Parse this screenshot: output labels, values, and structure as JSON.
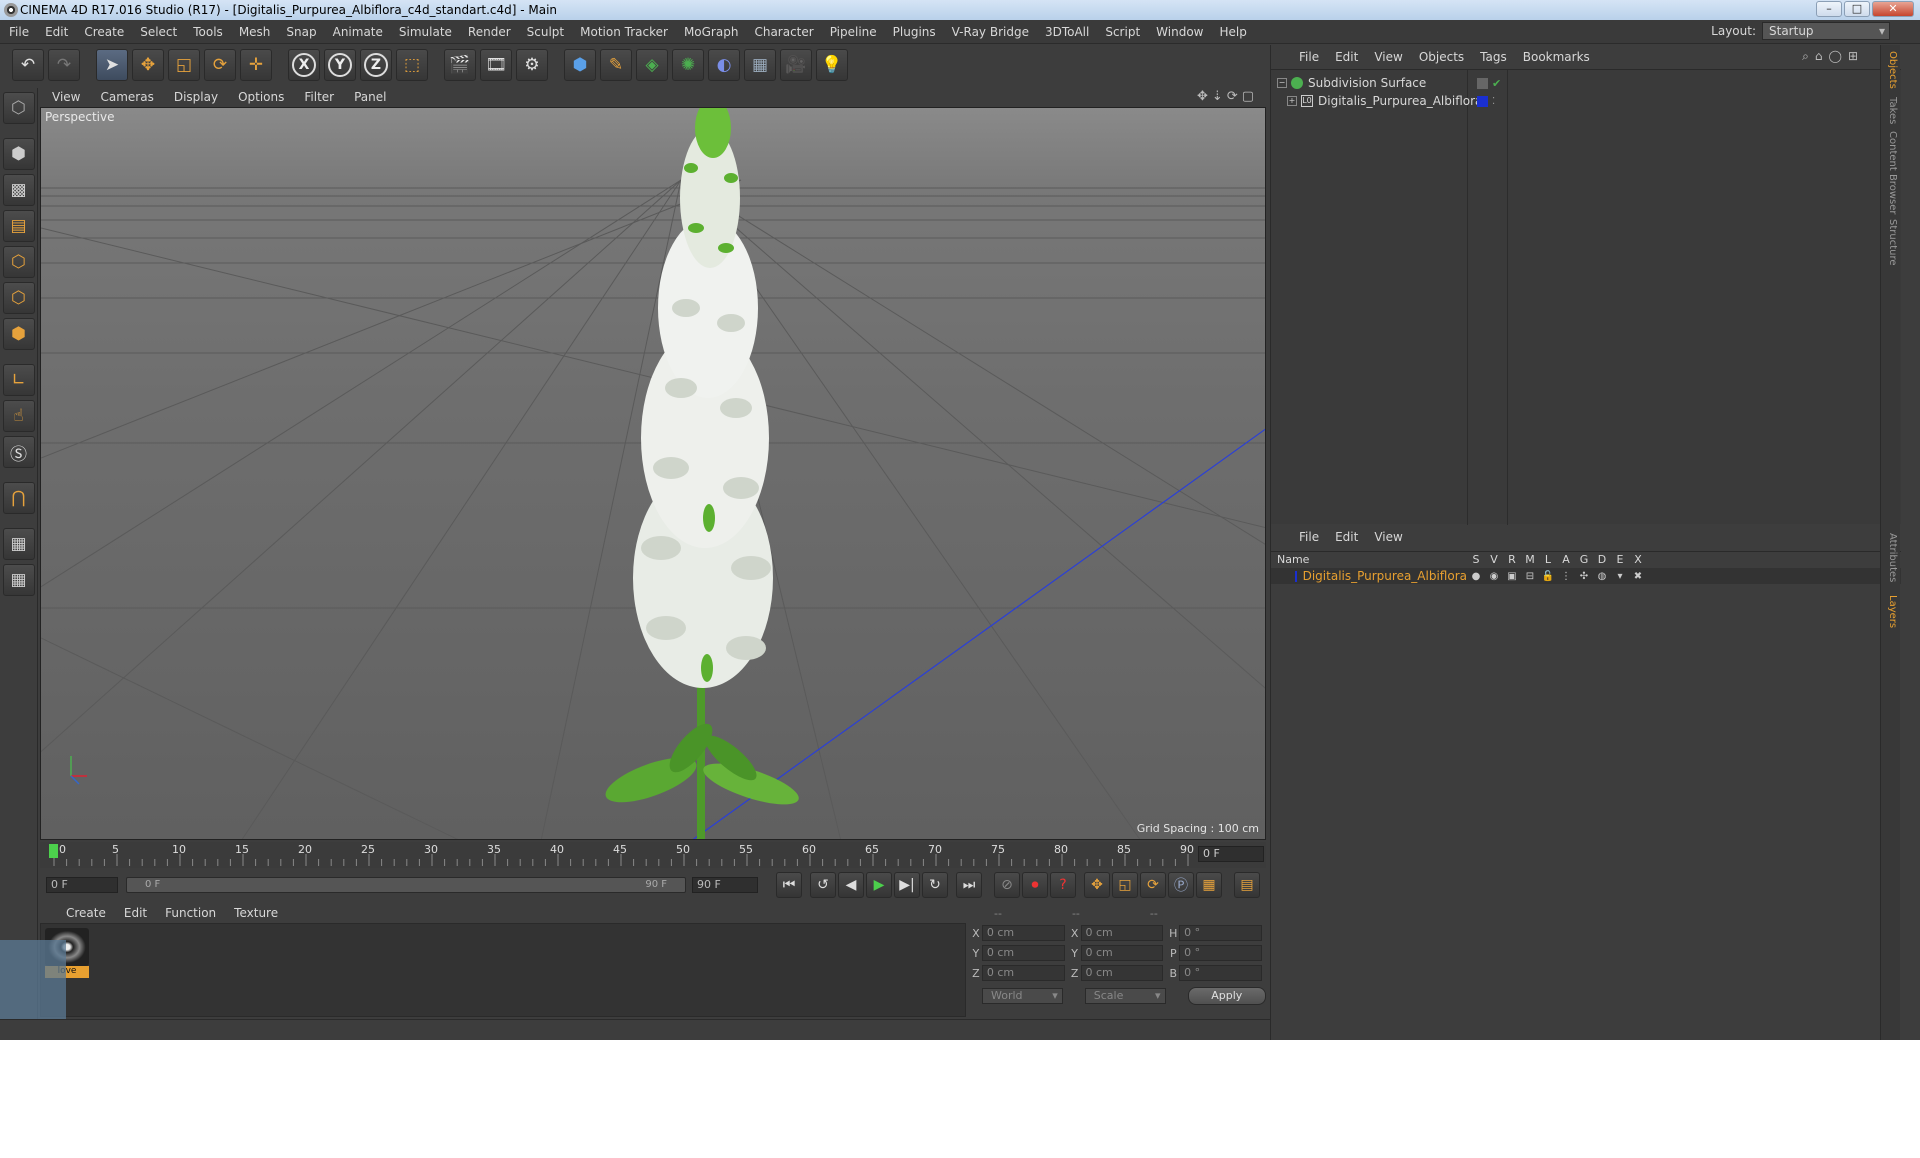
{
  "window": {
    "title": "CINEMA 4D R17.016 Studio (R17) - [Digitalis_Purpurea_Albiflora_c4d_standart.c4d] - Main"
  },
  "menubar": {
    "items": [
      "File",
      "Edit",
      "Create",
      "Select",
      "Tools",
      "Mesh",
      "Snap",
      "Animate",
      "Simulate",
      "Render",
      "Sculpt",
      "Motion Tracker",
      "MoGraph",
      "Character",
      "Pipeline",
      "Plugins",
      "V-Ray Bridge",
      "3DToAll",
      "Script",
      "Window",
      "Help"
    ],
    "layout_label": "Layout:",
    "layout_value": "Startup"
  },
  "toolbar": {
    "icons": [
      "undo-icon",
      "redo-icon",
      "select-arrow-icon",
      "move-icon",
      "scale-icon",
      "rotate-icon",
      "add-icon",
      "x-axis-icon",
      "y-axis-icon",
      "z-axis-icon",
      "coordinate-system-icon",
      "render-view-icon",
      "render-picture-viewer-icon",
      "render-settings-icon",
      "cube-icon",
      "pen-icon",
      "subdivision-icon",
      "mograph-icon",
      "deformer-icon",
      "floor-icon",
      "camera-icon",
      "light-icon"
    ],
    "axis_x": "X",
    "axis_y": "Y",
    "axis_z": "Z"
  },
  "viewport": {
    "menu": [
      "View",
      "Cameras",
      "Display",
      "Options",
      "Filter",
      "Panel"
    ],
    "label": "Perspective",
    "grid_spacing": "Grid Spacing : 100 cm"
  },
  "timeline": {
    "ticks": [
      "0",
      "5",
      "10",
      "15",
      "20",
      "25",
      "30",
      "35",
      "40",
      "45",
      "50",
      "55",
      "60",
      "65",
      "70",
      "75",
      "80",
      "85",
      "90"
    ],
    "current_frame": "0 F",
    "start_field": "0 F",
    "range_start": "0 F",
    "range_end": "90 F",
    "end_field": "90 F"
  },
  "material_manager": {
    "menu": [
      "Create",
      "Edit",
      "Function",
      "Texture"
    ],
    "material_label": "love"
  },
  "coordinates": {
    "headers": [
      "--",
      "--",
      "--"
    ],
    "rows": [
      {
        "a": "X",
        "av": "0 cm",
        "b": "X",
        "bv": "0 cm",
        "c": "H",
        "cv": "0 °"
      },
      {
        "a": "Y",
        "av": "0 cm",
        "b": "Y",
        "bv": "0 cm",
        "c": "P",
        "cv": "0 °"
      },
      {
        "a": "Z",
        "av": "0 cm",
        "b": "Z",
        "bv": "0 cm",
        "c": "B",
        "cv": "0 °"
      }
    ],
    "space": "World",
    "mode": "Scale",
    "apply": "Apply"
  },
  "object_manager": {
    "menu": [
      "File",
      "Edit",
      "View",
      "Objects",
      "Tags",
      "Bookmarks"
    ],
    "objects": [
      {
        "name": "Subdivision Surface"
      },
      {
        "name": "Digitalis_Purpurea_Albiflora"
      }
    ]
  },
  "layer_manager": {
    "menu": [
      "File",
      "Edit",
      "View"
    ],
    "columns": [
      "Name",
      "S",
      "V",
      "R",
      "M",
      "L",
      "A",
      "G",
      "D",
      "E",
      "X"
    ],
    "layer": "Digitalis_Purpurea_Albiflora"
  },
  "side_tabs": [
    "Objects",
    "Takes",
    "Content Browser",
    "Structure",
    "Attributes",
    "Layers"
  ],
  "colors": {
    "accent": "#e8a030",
    "layer_blue": "#1a2fd0",
    "check_green": "#4caf50"
  }
}
